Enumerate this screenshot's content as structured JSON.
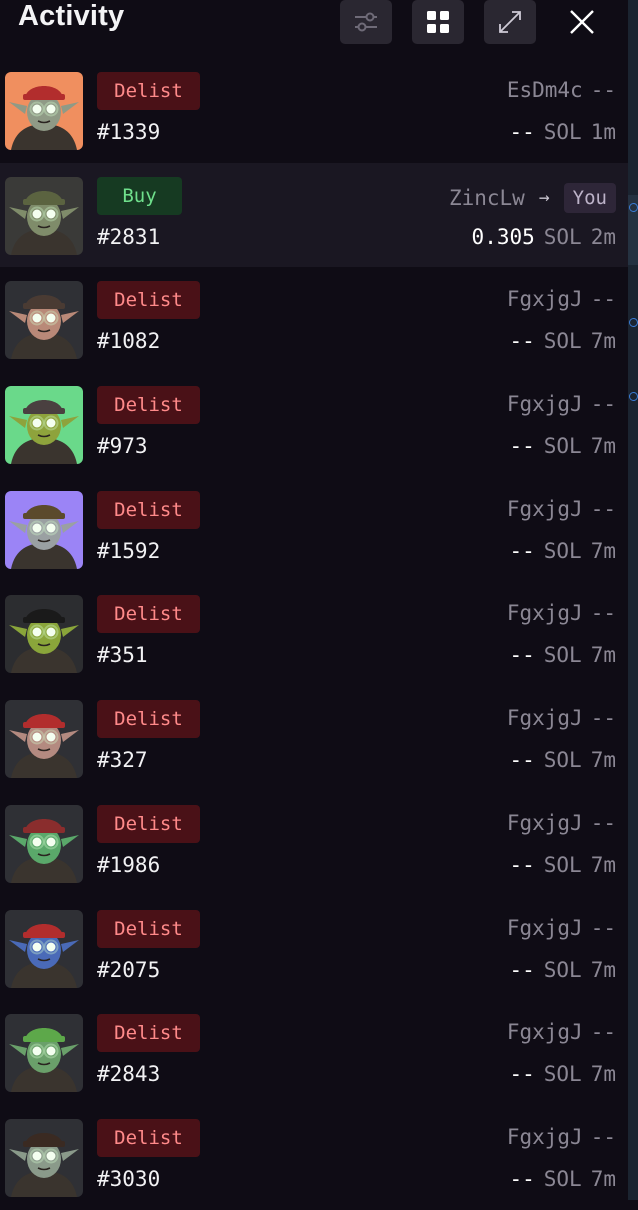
{
  "header": {
    "title": "Activity",
    "buttons": [
      {
        "icon": "sliders-icon"
      },
      {
        "icon": "grid-icon"
      },
      {
        "icon": "expand-icon"
      },
      {
        "icon": "close-icon"
      }
    ]
  },
  "colors": {
    "background": "#0f0c15",
    "delist_bg": "#4a1117",
    "delist_text": "#ff8a8a",
    "buy_bg": "#163a22",
    "buy_text": "#6fe08c",
    "muted_text": "#8b8794"
  },
  "activity": [
    {
      "type": "Delist",
      "id": "#1339",
      "from": "EsDm4c",
      "to": "--",
      "price": "--",
      "currency": "SOL",
      "time": "1m",
      "thumb_bg": "#f08f5f",
      "skin": "#8f9a86",
      "hat": "#b22d2d"
    },
    {
      "type": "Buy",
      "id": "#2831",
      "from": "ZincLw",
      "arrow": "→",
      "to": "You",
      "price": "0.305",
      "currency": "SOL",
      "time": "2m",
      "thumb_bg": "#3a3a38",
      "skin": "#7f8c6a",
      "hat": "#5b6340"
    },
    {
      "type": "Delist",
      "id": "#1082",
      "from": "FgxjgJ",
      "to": "--",
      "price": "--",
      "currency": "SOL",
      "time": "7m",
      "thumb_bg": "#2f3035",
      "skin": "#b98978",
      "hat": "#4a3b33"
    },
    {
      "type": "Delist",
      "id": "#973",
      "from": "FgxjgJ",
      "to": "--",
      "price": "--",
      "currency": "SOL",
      "time": "7m",
      "thumb_bg": "#6ad98a",
      "skin": "#8ea33c",
      "hat": "#4a4040"
    },
    {
      "type": "Delist",
      "id": "#1592",
      "from": "FgxjgJ",
      "to": "--",
      "price": "--",
      "currency": "SOL",
      "time": "7m",
      "thumb_bg": "#9b84f6",
      "skin": "#9aa0a2",
      "hat": "#5b4a2c"
    },
    {
      "type": "Delist",
      "id": "#351",
      "from": "FgxjgJ",
      "to": "--",
      "price": "--",
      "currency": "SOL",
      "time": "7m",
      "thumb_bg": "#2c2d30",
      "skin": "#8aa53a",
      "hat": "#1a1a1a"
    },
    {
      "type": "Delist",
      "id": "#327",
      "from": "FgxjgJ",
      "to": "--",
      "price": "--",
      "currency": "SOL",
      "time": "7m",
      "thumb_bg": "#2f3035",
      "skin": "#b48a80",
      "hat": "#b22d2d"
    },
    {
      "type": "Delist",
      "id": "#1986",
      "from": "FgxjgJ",
      "to": "--",
      "price": "--",
      "currency": "SOL",
      "time": "7m",
      "thumb_bg": "#2f3035",
      "skin": "#5aa86a",
      "hat": "#8a2d2d"
    },
    {
      "type": "Delist",
      "id": "#2075",
      "from": "FgxjgJ",
      "to": "--",
      "price": "--",
      "currency": "SOL",
      "time": "7m",
      "thumb_bg": "#2f3035",
      "skin": "#4a6ab8",
      "hat": "#b22d2d"
    },
    {
      "type": "Delist",
      "id": "#2843",
      "from": "FgxjgJ",
      "to": "--",
      "price": "--",
      "currency": "SOL",
      "time": "7m",
      "thumb_bg": "#2f3035",
      "skin": "#6aa06a",
      "hat": "#5da84a"
    },
    {
      "type": "Delist",
      "id": "#3030",
      "from": "FgxjgJ",
      "to": "--",
      "price": "--",
      "currency": "SOL",
      "time": "7m",
      "thumb_bg": "#2f3035",
      "skin": "#8a9a8a",
      "hat": "#3a2a22"
    }
  ]
}
